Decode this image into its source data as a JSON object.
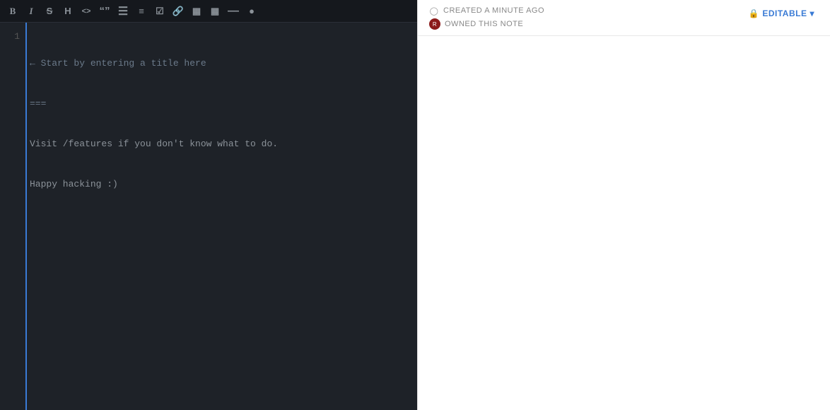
{
  "toolbar": {
    "buttons": [
      {
        "id": "bold",
        "label": "B",
        "class": "icon-bold"
      },
      {
        "id": "italic",
        "label": "I",
        "class": "icon-italic"
      },
      {
        "id": "strikethrough",
        "label": "S",
        "class": "icon-strike"
      },
      {
        "id": "heading",
        "label": "H"
      },
      {
        "id": "code-inline",
        "label": "<>"
      },
      {
        "id": "quote",
        "label": "“”"
      },
      {
        "id": "unordered-list",
        "label": "≡"
      },
      {
        "id": "ordered-list",
        "label": "☰"
      },
      {
        "id": "checkbox",
        "label": "☐"
      },
      {
        "id": "link",
        "label": "🔗"
      },
      {
        "id": "image",
        "label": "🖼"
      },
      {
        "id": "table",
        "label": "⋞"
      },
      {
        "id": "hr",
        "label": "—"
      },
      {
        "id": "comment",
        "label": "◯"
      }
    ]
  },
  "editor": {
    "line_number": "1",
    "line1": "← Start by entering a title here",
    "line2": "===",
    "line3": "Visit /features if you don't know what to do.",
    "line4": "Happy hacking :)"
  },
  "preview": {
    "created_label": "CREATED A MINUTE AGO",
    "owned_label": "OWNED THIS NOTE",
    "editable_label": "EDITABLE",
    "editable_dropdown": "▾",
    "owner_initial": "R"
  }
}
